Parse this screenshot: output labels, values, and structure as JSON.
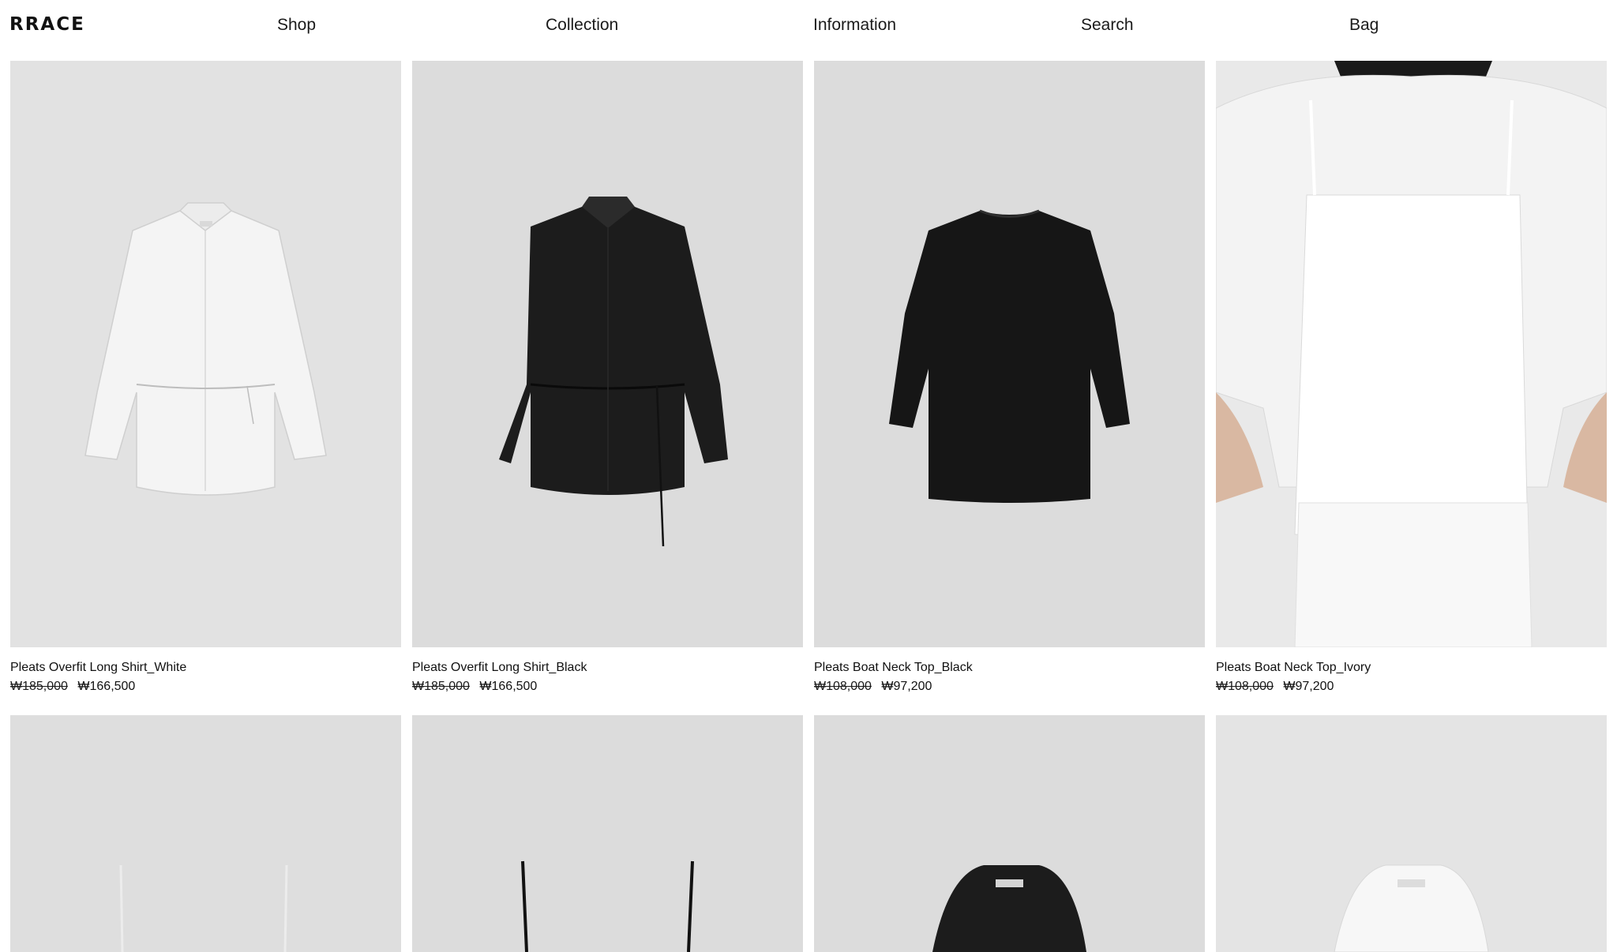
{
  "brand": {
    "logo_text": "RRACE"
  },
  "nav": {
    "shop": "Shop",
    "collection": "Collection",
    "information": "Information",
    "search": "Search",
    "bag": "Bag"
  },
  "products": [
    {
      "name": "Pleats Overfit Long Shirt_White",
      "original_price": "₩185,000",
      "sale_price": "₩166,500",
      "image": "white-shirt-with-belt"
    },
    {
      "name": "Pleats Overfit Long Shirt_Black",
      "original_price": "₩185,000",
      "sale_price": "₩166,500",
      "image": "black-shirt-with-belt"
    },
    {
      "name": "Pleats Boat Neck Top_Black",
      "original_price": "₩108,000",
      "sale_price": "₩97,200",
      "image": "black-boat-neck-top"
    },
    {
      "name": "Pleats Boat Neck Top_Ivory",
      "original_price": "₩108,000",
      "sale_price": "₩97,200",
      "image": "model-wearing-ivory-top"
    }
  ],
  "row2_images": [
    "white-camisole",
    "black-camisole",
    "black-collar-shirt",
    "white-collar-shirt"
  ],
  "colors": {
    "photo_background": "#dcdcdc",
    "text": "#111111",
    "background": "#ffffff"
  }
}
